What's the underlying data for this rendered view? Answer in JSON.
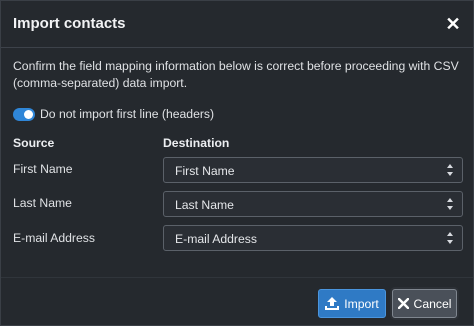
{
  "dialog": {
    "title": "Import contacts",
    "close_icon": "close-icon",
    "intro": "Confirm the field mapping information below is correct before proceeding with CSV (comma-separated) data import.",
    "toggle": {
      "label": "Do not import first line (headers)",
      "on": true
    },
    "columns": {
      "source": "Source",
      "destination": "Destination"
    },
    "mappings": [
      {
        "source": "First Name",
        "destination": "First Name"
      },
      {
        "source": "Last Name",
        "destination": "Last Name"
      },
      {
        "source": "E-mail Address",
        "destination": "E-mail Address"
      }
    ],
    "buttons": {
      "import": {
        "label": "Import",
        "icon": "upload-icon"
      },
      "cancel": {
        "label": "Cancel",
        "icon": "close-icon"
      }
    }
  },
  "colors": {
    "accent": "#2f86d8",
    "background": "#25292e",
    "import_button": "#2f7ac5",
    "cancel_button": "#4a5059"
  }
}
